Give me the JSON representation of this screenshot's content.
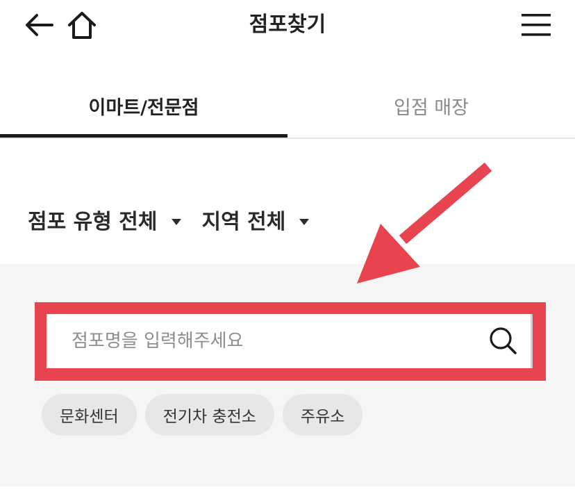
{
  "header": {
    "title": "점포찾기",
    "back_icon": "arrow-left-icon",
    "home_icon": "home-icon",
    "menu_icon": "hamburger-menu-icon"
  },
  "tabs": [
    {
      "label": "이마트/전문점",
      "active": true
    },
    {
      "label": "입점 매장",
      "active": false
    }
  ],
  "filters": {
    "store_type": "점포 유형 전체",
    "region": "지역 전체"
  },
  "search": {
    "placeholder": "점포명을 입력해주세요",
    "value": "",
    "icon": "search-icon"
  },
  "chips": [
    {
      "label": "문화센터"
    },
    {
      "label": "전기차 충전소"
    },
    {
      "label": "주유소"
    }
  ],
  "annotation": {
    "color": "#e8444f",
    "arrow_icon": "red-arrow-icon"
  }
}
